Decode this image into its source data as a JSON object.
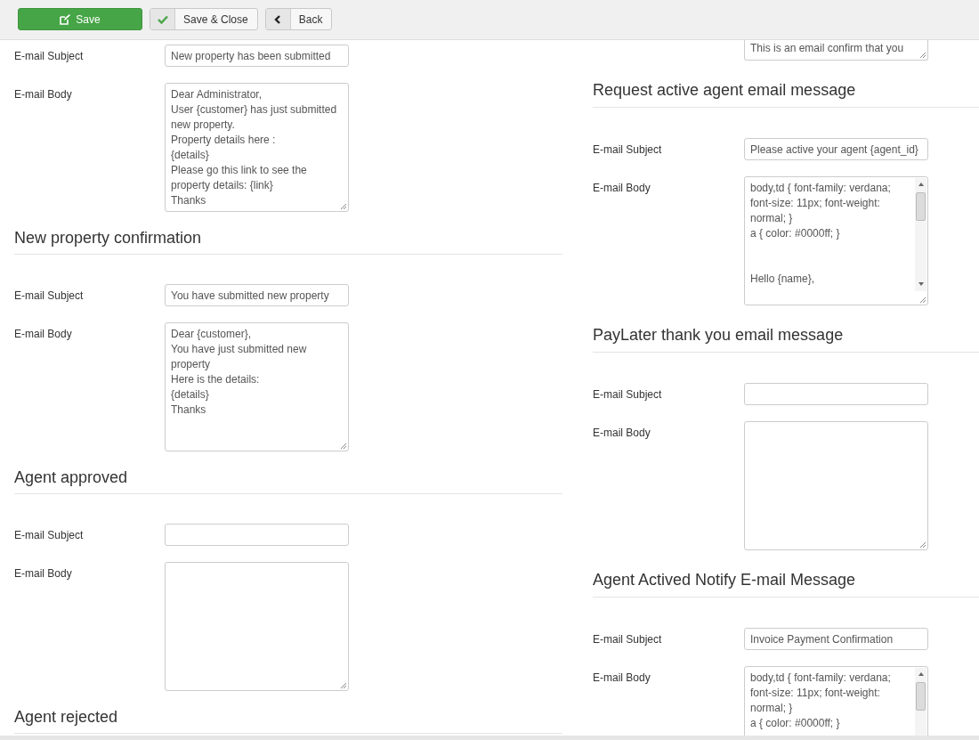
{
  "toolbar": {
    "buttons": [
      {
        "label": "Save",
        "kind": "primary"
      },
      {
        "label": "Save & Close",
        "kind": "check"
      },
      {
        "label": "Back",
        "kind": "back"
      }
    ]
  },
  "columns": [
    {
      "sections": [
        {
          "subject_label": "E-mail Subject",
          "subject": "New property has been submitted",
          "body_label": "E-mail Body",
          "body": "Dear Administrator,\nUser {customer} has just submitted\nnew property.\nProperty details here :\n{details}\nPlease go this link to see the\nproperty details: {link}\nThanks",
          "kind": "plain"
        },
        {
          "heading": "New property confirmation",
          "subject_label": "E-mail Subject",
          "subject": "You have submitted new property",
          "body_label": "E-mail Body",
          "body": "Dear {customer},\nYou have just submitted new\nproperty\nHere is the details:\n{details}\nThanks",
          "kind": "plain"
        },
        {
          "heading": "Agent approved",
          "subject_label": "E-mail Subject",
          "body_label": "E-mail Body",
          "kind": "plain"
        },
        {
          "heading": "Agent rejected"
        }
      ]
    },
    {
      "fragment": "This is an email confirm that you",
      "sections": [
        {
          "heading": "Request active agent email message",
          "subject_label": "E-mail Subject",
          "subject": "Please active your agent {agent_id}",
          "body_label": "E-mail Body",
          "body": "body,td { font-family: verdana;\nfont-size: 11px; font-weight:\nnormal; }\na { color: #0000ff; }\n\n\nHello {name},",
          "kind": "scroll"
        },
        {
          "heading": "PayLater thank you email message",
          "subject_label": "E-mail Subject",
          "body_label": "E-mail Body",
          "kind": "plain"
        },
        {
          "heading": "Agent Actived Notify E-mail Message",
          "subject_label": "E-mail Subject",
          "subject": "Invoice Payment Confirmation",
          "body_label": "E-mail Body",
          "body": "body,td { font-family: verdana;\nfont-size: 11px; font-weight:\nnormal; }\na { color: #0000ff; }",
          "kind": "scroll"
        }
      ]
    }
  ]
}
